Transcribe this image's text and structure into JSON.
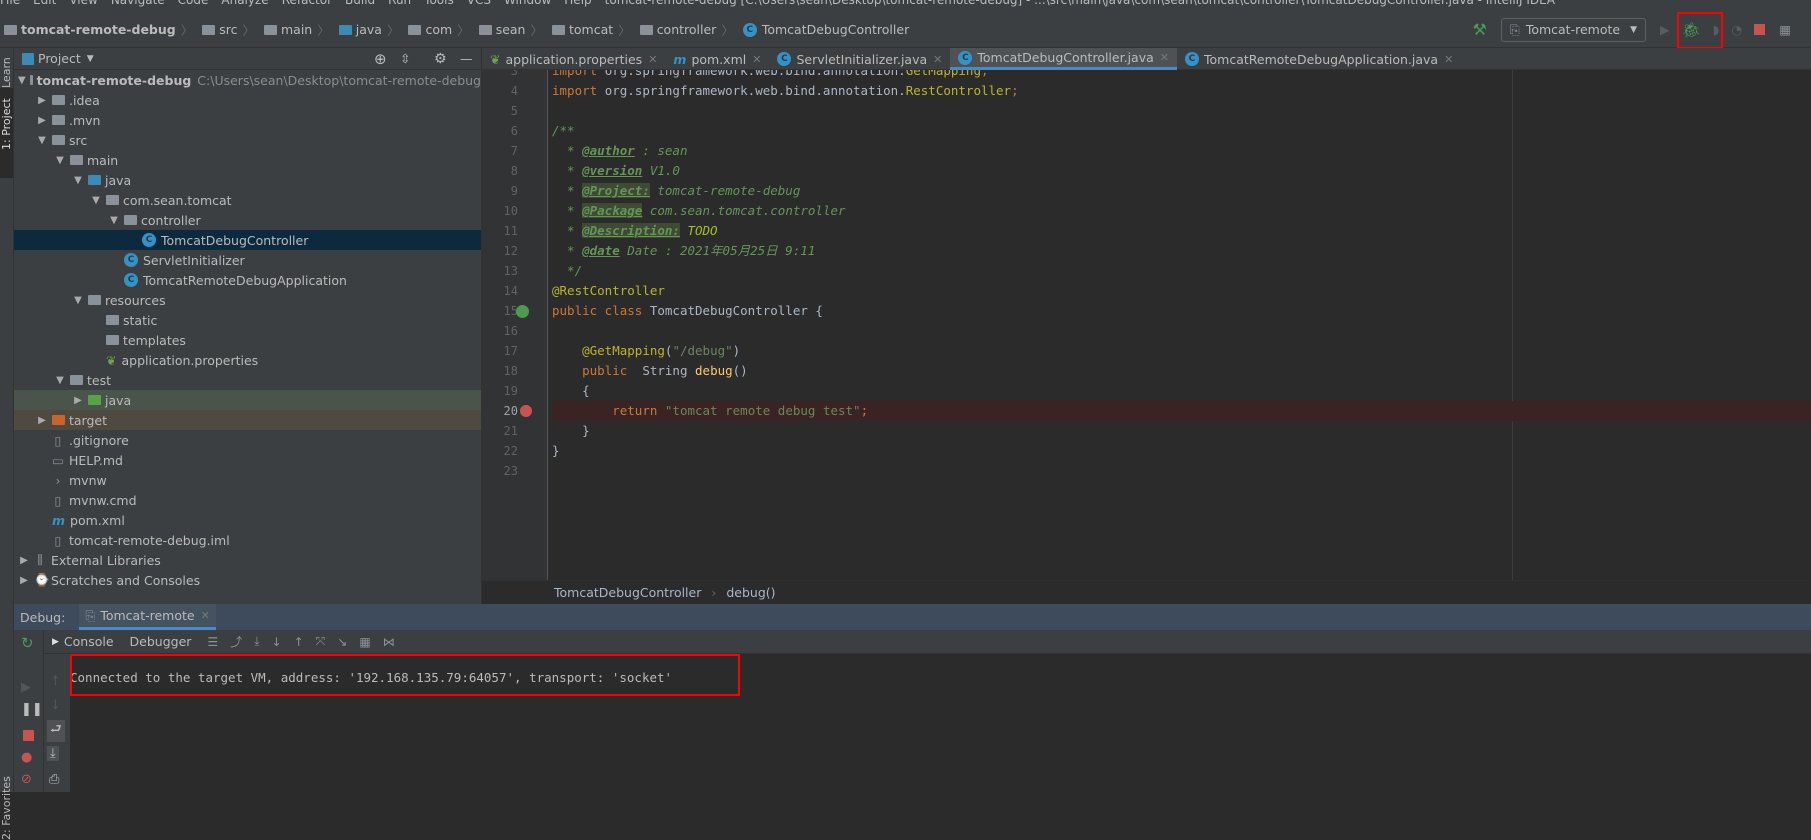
{
  "menubar": {
    "items": [
      "File",
      "Edit",
      "View",
      "Navigate",
      "Code",
      "Analyze",
      "Refactor",
      "Build",
      "Run",
      "Tools",
      "VCS",
      "Window",
      "Help"
    ],
    "title": "tomcat-remote-debug [C:\\Users\\sean\\Desktop\\tomcat-remote-debug] - ...\\src\\main\\java\\com\\sean\\tomcat\\controller\\TomcatDebugController.java - IntelliJ IDEA"
  },
  "navbar": {
    "crumbs": [
      "tomcat-remote-debug",
      "src",
      "main",
      "java",
      "com",
      "sean",
      "tomcat",
      "controller",
      "TomcatDebugController"
    ],
    "run_config": "Tomcat-remote"
  },
  "sidestrip": {
    "learn": "Learn",
    "project": "1: Project",
    "favorites": "2: Favorites"
  },
  "project": {
    "title": "Project",
    "root_path": "C:\\Users\\sean\\Desktop\\tomcat-remote-debug",
    "tree": [
      {
        "label": "tomcat-remote-debug",
        "depth": 0,
        "arrow": "down",
        "icon": "module",
        "bold": true
      },
      {
        "label": ".idea",
        "depth": 1,
        "arrow": "right",
        "icon": "folder"
      },
      {
        "label": ".mvn",
        "depth": 1,
        "arrow": "right",
        "icon": "folder"
      },
      {
        "label": "src",
        "depth": 1,
        "arrow": "down",
        "icon": "folder"
      },
      {
        "label": "main",
        "depth": 2,
        "arrow": "down",
        "icon": "folder"
      },
      {
        "label": "java",
        "depth": 3,
        "arrow": "down",
        "icon": "folder-blue"
      },
      {
        "label": "com.sean.tomcat",
        "depth": 4,
        "arrow": "down",
        "icon": "package"
      },
      {
        "label": "controller",
        "depth": 5,
        "arrow": "down",
        "icon": "package"
      },
      {
        "label": "TomcatDebugController",
        "depth": 6,
        "arrow": "",
        "icon": "class",
        "selected": true
      },
      {
        "label": "ServletInitializer",
        "depth": 5,
        "arrow": "",
        "icon": "class"
      },
      {
        "label": "TomcatRemoteDebugApplication",
        "depth": 5,
        "arrow": "",
        "icon": "spring-class"
      },
      {
        "label": "resources",
        "depth": 3,
        "arrow": "down",
        "icon": "folder"
      },
      {
        "label": "static",
        "depth": 4,
        "arrow": "",
        "icon": "folder"
      },
      {
        "label": "templates",
        "depth": 4,
        "arrow": "",
        "icon": "folder"
      },
      {
        "label": "application.properties",
        "depth": 4,
        "arrow": "",
        "icon": "spring-properties"
      },
      {
        "label": "test",
        "depth": 2,
        "arrow": "down",
        "icon": "folder"
      },
      {
        "label": "java",
        "depth": 3,
        "arrow": "right",
        "icon": "folder-green",
        "row": "test"
      },
      {
        "label": "target",
        "depth": 1,
        "arrow": "right",
        "icon": "folder-orange",
        "row": "excl"
      },
      {
        "label": ".gitignore",
        "depth": 1,
        "arrow": "",
        "icon": "file"
      },
      {
        "label": "HELP.md",
        "depth": 1,
        "arrow": "",
        "icon": "markdown"
      },
      {
        "label": "mvnw",
        "depth": 1,
        "arrow": "",
        "icon": "shell"
      },
      {
        "label": "mvnw.cmd",
        "depth": 1,
        "arrow": "",
        "icon": "file"
      },
      {
        "label": "pom.xml",
        "depth": 1,
        "arrow": "",
        "icon": "maven"
      },
      {
        "label": "tomcat-remote-debug.iml",
        "depth": 1,
        "arrow": "",
        "icon": "file"
      },
      {
        "label": "External Libraries",
        "depth": 0,
        "arrow": "right",
        "icon": "libraries"
      },
      {
        "label": "Scratches and Consoles",
        "depth": 0,
        "arrow": "right",
        "icon": "scratches"
      }
    ]
  },
  "tabs": [
    {
      "label": "application.properties",
      "icon": "spring-properties"
    },
    {
      "label": "pom.xml",
      "icon": "maven"
    },
    {
      "label": "ServletInitializer.java",
      "icon": "class"
    },
    {
      "label": "TomcatDebugController.java",
      "icon": "class",
      "active": true
    },
    {
      "label": "TomcatRemoteDebugApplication.java",
      "icon": "spring-class"
    }
  ],
  "editor": {
    "lines": [
      {
        "n": "3",
        "t": [
          [
            "import ",
            "kw"
          ],
          [
            "org.springframework.web.bind.annotation.",
            "pl"
          ],
          [
            "GetMapping",
            "an"
          ],
          [
            ";",
            "kw"
          ]
        ]
      },
      {
        "n": "4",
        "t": [
          [
            "import ",
            "kw"
          ],
          [
            "org.springframework.web.bind.annotation.",
            "pl"
          ],
          [
            "RestController",
            "an"
          ],
          [
            ";",
            "kw"
          ]
        ]
      },
      {
        "n": "5",
        "t": []
      },
      {
        "n": "6",
        "t": [
          [
            "/**",
            "doc"
          ]
        ]
      },
      {
        "n": "7",
        "t": [
          [
            "  * ",
            "doc"
          ],
          [
            "@author",
            "tag"
          ],
          [
            " : sean",
            "doc"
          ]
        ]
      },
      {
        "n": "8",
        "t": [
          [
            "  * ",
            "doc"
          ],
          [
            "@version",
            "tag"
          ],
          [
            " V1.0",
            "doc"
          ]
        ]
      },
      {
        "n": "9",
        "t": [
          [
            "  * ",
            "doc"
          ],
          [
            "@Project:",
            "tag tagbg"
          ],
          [
            " tomcat-remote-debug",
            "doc"
          ]
        ]
      },
      {
        "n": "10",
        "t": [
          [
            "  * ",
            "doc"
          ],
          [
            "@Package",
            "tag tagbg"
          ],
          [
            " com.sean.tomcat.controller",
            "doc"
          ]
        ]
      },
      {
        "n": "11",
        "t": [
          [
            "  * ",
            "doc"
          ],
          [
            "@Description:",
            "tag tagbg"
          ],
          [
            " TODO",
            "todo"
          ]
        ]
      },
      {
        "n": "12",
        "t": [
          [
            "  * ",
            "doc"
          ],
          [
            "@date",
            "tag"
          ],
          [
            " Date : 2021年05月25日 9:11",
            "doc"
          ]
        ]
      },
      {
        "n": "13",
        "t": [
          [
            "  */",
            "doc"
          ]
        ]
      },
      {
        "n": "14",
        "t": [
          [
            "@RestController",
            "an"
          ]
        ]
      },
      {
        "n": "15",
        "t": [
          [
            "public class ",
            "kw"
          ],
          [
            "TomcatDebugController {",
            "pl"
          ]
        ]
      },
      {
        "n": "16",
        "t": []
      },
      {
        "n": "17",
        "t": [
          [
            "    ",
            "pl"
          ],
          [
            "@GetMapping",
            "an"
          ],
          [
            "(",
            "pl"
          ],
          [
            "\"/debug\"",
            "str"
          ],
          [
            ")",
            "pl"
          ]
        ]
      },
      {
        "n": "18",
        "t": [
          [
            "    ",
            "pl"
          ],
          [
            "public  ",
            "kw"
          ],
          [
            "String ",
            "pl"
          ],
          [
            "debug",
            "fn"
          ],
          [
            "()",
            "pl"
          ]
        ]
      },
      {
        "n": "19",
        "t": [
          [
            "    {",
            "pl"
          ]
        ]
      },
      {
        "n": "20",
        "t": [
          [
            "        ",
            "pl"
          ],
          [
            "return ",
            "kw"
          ],
          [
            "\"tomcat remote debug test\"",
            "str"
          ],
          [
            ";",
            "kw"
          ]
        ],
        "breakpoint": true
      },
      {
        "n": "21",
        "t": [
          [
            "    }",
            "pl"
          ]
        ]
      },
      {
        "n": "22",
        "t": [
          [
            "}",
            "pl"
          ]
        ]
      },
      {
        "n": "23",
        "t": []
      }
    ],
    "breadcrumbs": [
      "TomcatDebugController",
      "debug()"
    ]
  },
  "debug": {
    "label": "Debug:",
    "session": "Tomcat-remote",
    "tabs": [
      "Console",
      "Debugger"
    ],
    "console": "Connected to the target VM, address: '192.168.135.79:64057', transport: 'socket'"
  },
  "colors": {
    "highlight": "#ff0000",
    "accent": "#4a88c7"
  }
}
